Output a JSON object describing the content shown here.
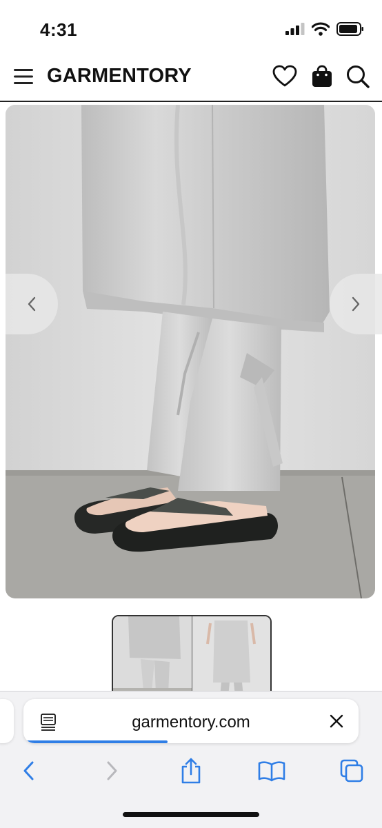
{
  "status_bar": {
    "time": "4:31"
  },
  "header": {
    "brand": "GARMENTORY",
    "icons": [
      "hamburger-menu-icon",
      "heart-icon",
      "shopping-bag-icon",
      "search-icon"
    ]
  },
  "product_gallery": {
    "main_image_description": "product-photo-satin-pants-and-flip-flops",
    "prev_icon": "chevron-left-icon",
    "next_icon": "chevron-right-icon",
    "thumbnails": [
      "thumbnail-1",
      "thumbnail-2"
    ]
  },
  "browser": {
    "url": "garmentory.com",
    "load_progress": 0.43,
    "toolbar": [
      "back-icon",
      "forward-icon",
      "share-icon",
      "bookmarks-icon",
      "tabs-icon"
    ]
  },
  "colors": {
    "progress": "#2f7ee6",
    "toolbar_blue": "#2f7ee6",
    "disabled_gray": "#b8b8bc"
  }
}
